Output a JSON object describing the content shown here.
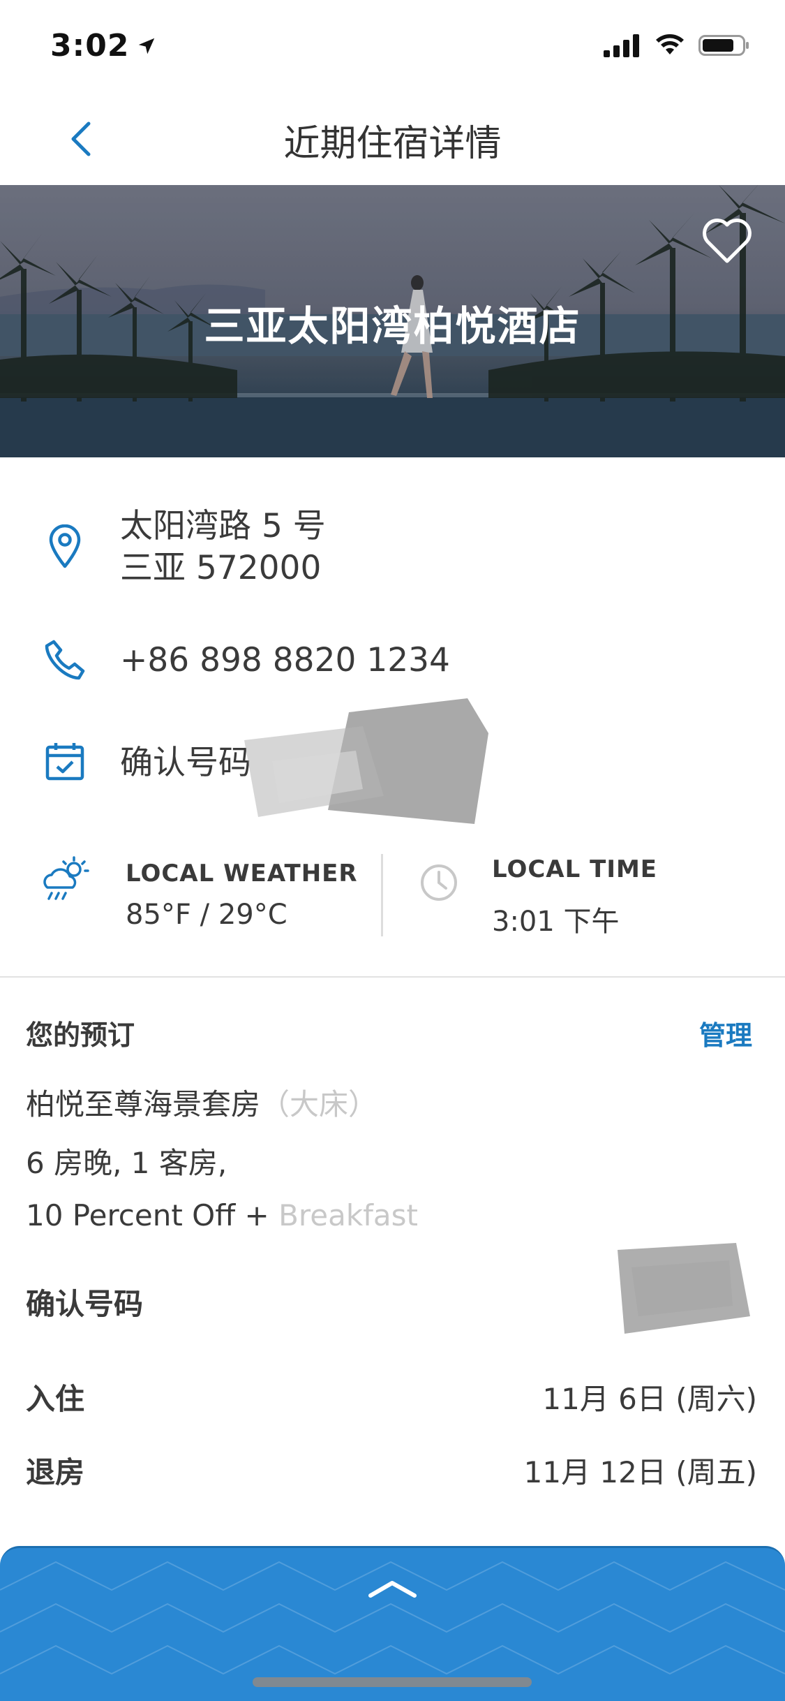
{
  "status_bar": {
    "time": "3:02",
    "icons": [
      "location-arrow-icon",
      "signal-icon",
      "wifi-icon",
      "battery-icon"
    ]
  },
  "nav": {
    "title": "近期住宿详情",
    "back_icon": "chevron-left-icon"
  },
  "hotel": {
    "name": "三亚太阳湾柏悦酒店",
    "favorite_icon": "heart-outline-icon"
  },
  "address": {
    "line1": "太阳湾路 5 号",
    "line2": "三亚 572000"
  },
  "phone": "+86 898 8820 1234",
  "confirmation_top": {
    "label": "确认号码"
  },
  "weather": {
    "label": "LOCAL WEATHER",
    "value": "85°F / 29°C"
  },
  "local_time": {
    "label": "LOCAL TIME",
    "value": "3:01 下午"
  },
  "booking": {
    "heading": "您的预订",
    "manage_label": "管理",
    "room_type": "柏悦至尊海景套房",
    "room_type_faded": "（大床）",
    "nights_guests": "6 房晚, 1 客房,",
    "rate_plan": "10 Percent Off + ",
    "rate_plan_faded": "Breakfast",
    "confirmation_label": "确认号码",
    "checkin_label": "入住",
    "checkin_value": "11月 6日 (周六)",
    "checkout_label": "退房",
    "checkout_value": "11月 12日 (周五)"
  },
  "colors": {
    "accent": "#1a7ac0",
    "sheet": "#2a88d3",
    "text": "#3a3a3a"
  }
}
